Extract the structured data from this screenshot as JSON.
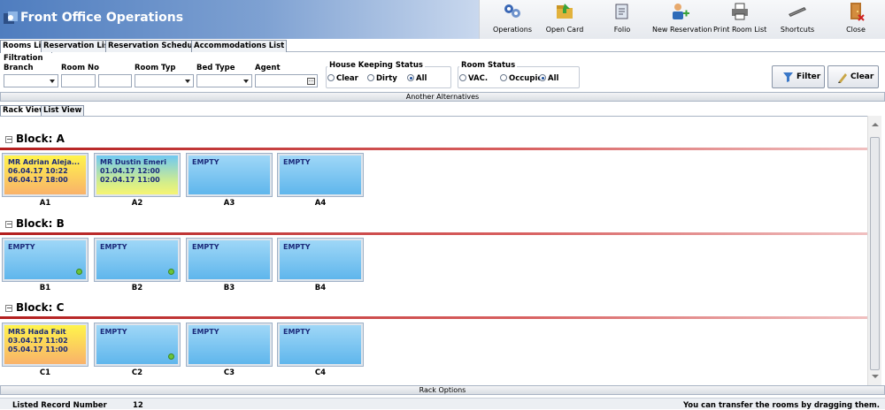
{
  "app": {
    "title": "Front Office Operations"
  },
  "toolbar": [
    {
      "label": "Operations",
      "icon": "operations-icon"
    },
    {
      "label": "Open Card",
      "icon": "open-card-icon"
    },
    {
      "label": "Folio",
      "icon": "folio-icon"
    },
    {
      "label": "New Reservation",
      "icon": "new-reservation-icon"
    },
    {
      "label": "Print Room List",
      "icon": "print-icon"
    },
    {
      "label": "Shortcuts",
      "icon": "shortcuts-icon"
    },
    {
      "label": "Close",
      "icon": "close-door-icon"
    }
  ],
  "tabs": [
    "Rooms List",
    "Reservation List",
    "Reservation Schedule",
    "Accommodations List"
  ],
  "filtration": {
    "title": "Filtration",
    "branch_label": "Branch",
    "room_no_label": "Room No",
    "room_type_label": "Room Typ",
    "bed_type_label": "Bed Type",
    "agent_label": "Agent",
    "housekeeping": {
      "title": "House Keeping Status",
      "options": [
        "Clear",
        "Dirty",
        "All"
      ],
      "selected": "All"
    },
    "room_status": {
      "title": "Room Status",
      "options": [
        "VAC.",
        "Occupie",
        "All"
      ],
      "selected": "All"
    },
    "filter_label": "Filter",
    "clear_label": "Clear"
  },
  "alternatives_label": "Another Alternatives",
  "subtabs": [
    "Rack View",
    "List View"
  ],
  "blocks": [
    {
      "name": "Block: A",
      "rooms": [
        {
          "no": "A1",
          "state": "occupied",
          "guest": "MR Adrian Aleja...",
          "in": "06.04.17 10:22",
          "out": "06.04.17 18:00"
        },
        {
          "no": "A2",
          "state": "occupied-due",
          "guest": "MR Dustin Emeri",
          "in": "01.04.17 12:00",
          "out": "02.04.17 11:00"
        },
        {
          "no": "A3",
          "state": "empty",
          "text": "EMPTY"
        },
        {
          "no": "A4",
          "state": "empty",
          "text": "EMPTY"
        }
      ]
    },
    {
      "name": "Block: B",
      "rooms": [
        {
          "no": "B1",
          "state": "empty",
          "text": "EMPTY",
          "clean": true
        },
        {
          "no": "B2",
          "state": "empty",
          "text": "EMPTY",
          "clean": true
        },
        {
          "no": "B3",
          "state": "empty",
          "text": "EMPTY"
        },
        {
          "no": "B4",
          "state": "empty",
          "text": "EMPTY"
        }
      ]
    },
    {
      "name": "Block: C",
      "rooms": [
        {
          "no": "C1",
          "state": "occupied",
          "guest": "MRS Hada Fait",
          "in": "03.04.17 11:02",
          "out": "05.04.17 11:00"
        },
        {
          "no": "C2",
          "state": "empty",
          "text": "EMPTY",
          "clean": true
        },
        {
          "no": "C3",
          "state": "empty",
          "text": "EMPTY"
        },
        {
          "no": "C4",
          "state": "empty",
          "text": "EMPTY"
        }
      ]
    }
  ],
  "rack_options_label": "Rack Options",
  "status": {
    "listed_label": "Listed Record Number",
    "listed_count": "12",
    "hint": "You can transfer the rooms by dragging them."
  }
}
